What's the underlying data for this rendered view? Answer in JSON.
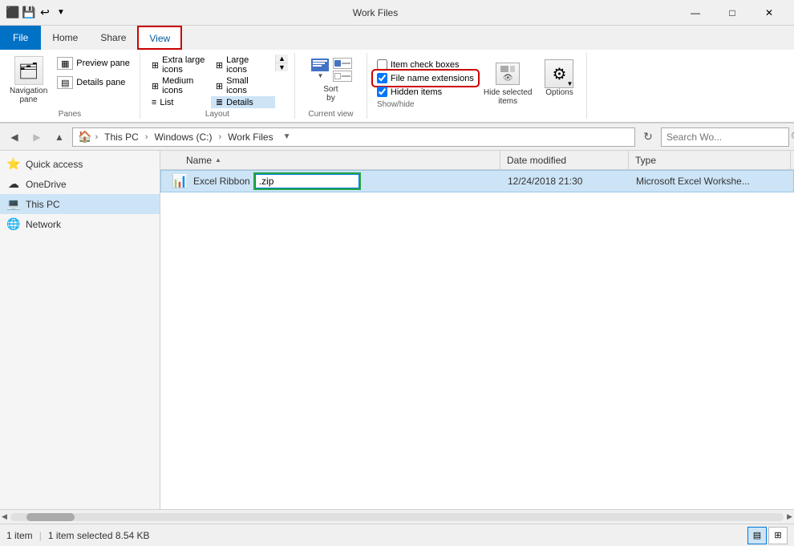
{
  "window": {
    "title": "Work Files",
    "title_icon": "📁"
  },
  "title_controls": {
    "minimize": "—",
    "maximize": "□",
    "close": "✕"
  },
  "ribbon": {
    "tabs": [
      {
        "id": "file",
        "label": "File",
        "type": "file"
      },
      {
        "id": "home",
        "label": "Home"
      },
      {
        "id": "share",
        "label": "Share"
      },
      {
        "id": "view",
        "label": "View",
        "active": true,
        "highlighted": true
      }
    ],
    "groups": {
      "panes": {
        "label": "Panes",
        "nav_pane_label": "Navigation\npane",
        "preview_pane_label": "Preview pane",
        "details_pane_label": "Details pane"
      },
      "layout": {
        "label": "Layout",
        "items": [
          {
            "label": "Extra large icons",
            "active": false
          },
          {
            "label": "Large icons",
            "active": false
          },
          {
            "label": "Medium icons",
            "active": false
          },
          {
            "label": "Small icons",
            "active": false
          },
          {
            "label": "List",
            "active": false
          },
          {
            "label": "Details",
            "active": true
          }
        ]
      },
      "current_view": {
        "label": "Current view",
        "sort_by_label": "Sort\nby"
      },
      "show_hide": {
        "label": "Show/hide",
        "checkboxes": [
          {
            "label": "Item check boxes",
            "checked": false,
            "id": "item-cb"
          },
          {
            "label": "File name extensions",
            "checked": true,
            "id": "file-ext-cb",
            "highlighted": true
          },
          {
            "label": "Hidden items",
            "checked": true,
            "id": "hidden-cb"
          }
        ],
        "hide_selected_label": "Hide selected\nitems",
        "options_label": "Options"
      }
    }
  },
  "address_bar": {
    "back_disabled": false,
    "forward_disabled": true,
    "path_parts": [
      "This PC",
      "Windows (C:)",
      "Work Files"
    ],
    "search_placeholder": "Search Wo..."
  },
  "sidebar": {
    "items": [
      {
        "label": "Quick access",
        "icon": "⭐",
        "active": false
      },
      {
        "label": "OneDrive",
        "icon": "☁",
        "active": false
      },
      {
        "label": "This PC",
        "icon": "💻",
        "active": true
      },
      {
        "label": "Network",
        "icon": "🌐",
        "active": false
      }
    ]
  },
  "file_list": {
    "columns": [
      {
        "label": "Name",
        "id": "name"
      },
      {
        "label": "Date modified",
        "id": "date"
      },
      {
        "label": "Type",
        "id": "type"
      }
    ],
    "files": [
      {
        "icon": "📊",
        "name": "Excel Ribbon",
        "ext": ".zip",
        "editing": true,
        "date": "12/24/2018 21:30",
        "type": "Microsoft Excel Workshe...",
        "selected": true
      }
    ]
  },
  "status_bar": {
    "item_count": "1 item",
    "selected_info": "1 item selected  8.54 KB",
    "item_label": "Item"
  }
}
